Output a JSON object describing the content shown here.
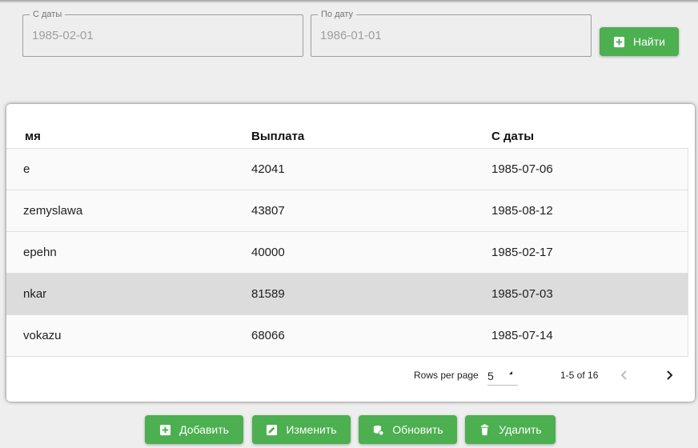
{
  "filters": {
    "from": {
      "label": "С даты",
      "value": "1985-02-01"
    },
    "to": {
      "label": "По дату",
      "value": "1986-01-01"
    },
    "search_label": "Найти"
  },
  "table": {
    "columns": [
      "мя",
      "Выплата",
      "С даты"
    ],
    "rows": [
      {
        "name": "e",
        "payment": "42041",
        "date": "1985-07-06",
        "selected": false
      },
      {
        "name": "zemyslawa",
        "payment": "43807",
        "date": "1985-08-12",
        "selected": false
      },
      {
        "name": "epehn",
        "payment": "40000",
        "date": "1985-02-17",
        "selected": false
      },
      {
        "name": "nkar",
        "payment": "81589",
        "date": "1985-07-03",
        "selected": true
      },
      {
        "name": "vokazu",
        "payment": "68066",
        "date": "1985-07-14",
        "selected": false
      }
    ],
    "pagination": {
      "rows_per_page_label": "Rows per page",
      "rows_per_page_value": "5",
      "range_text": "1-5 of 16"
    }
  },
  "actions": {
    "add_label": "Добавить",
    "edit_label": "Изменить",
    "refresh_label": "Обновить",
    "delete_label": "Удалить"
  },
  "colors": {
    "accent": "#4caf50",
    "selected_row": "#dcdcdc"
  }
}
